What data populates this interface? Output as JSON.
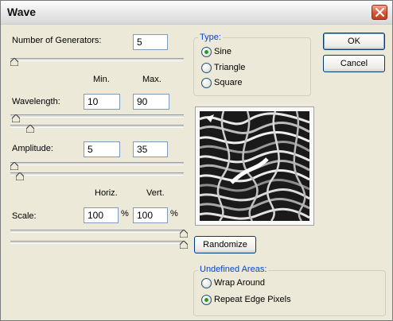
{
  "window": {
    "title": "Wave"
  },
  "generators": {
    "label": "Number of Generators:",
    "value": "5",
    "level": 0.0
  },
  "columns": {
    "min": "Min.",
    "max": "Max.",
    "horiz": "Horiz.",
    "vert": "Vert."
  },
  "wavelength": {
    "label": "Wavelength:",
    "min": "10",
    "max": "90",
    "min_level": 0.01,
    "max_level": 0.09
  },
  "amplitude": {
    "label": "Amplitude:",
    "min": "5",
    "max": "35",
    "min_level": 0.0,
    "max_level": 0.03
  },
  "scale": {
    "label": "Scale:",
    "horiz": "100",
    "vert": "100",
    "unit": "%",
    "horiz_level": 1.0,
    "vert_level": 1.0
  },
  "type": {
    "title": "Type:",
    "options": [
      "Sine",
      "Triangle",
      "Square"
    ],
    "selected": "Sine"
  },
  "buttons": {
    "ok": "OK",
    "cancel": "Cancel",
    "randomize": "Randomize"
  },
  "undefined_areas": {
    "title": "Undefined Areas:",
    "options": [
      "Wrap Around",
      "Repeat Edge Pixels"
    ],
    "selected": "Repeat Edge Pixels"
  },
  "icons": {
    "close": "close-icon",
    "thumb": "slider-thumb-icon"
  },
  "colors": {
    "group_title": "#0046d5",
    "radio_selected": "#21a121",
    "close_button": "#d9532e"
  }
}
